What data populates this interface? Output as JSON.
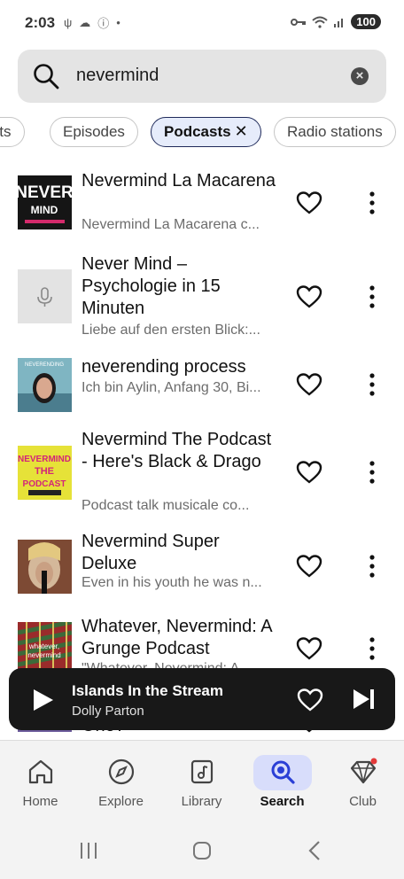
{
  "status_bar": {
    "time": "2:03",
    "battery": "100"
  },
  "search": {
    "query": "nevermind"
  },
  "filters": [
    {
      "label": "ists",
      "active": false
    },
    {
      "label": "Episodes",
      "active": false
    },
    {
      "label": "Podcasts",
      "active": true
    },
    {
      "label": "Radio stations",
      "active": false
    }
  ],
  "results": [
    {
      "title": "Nevermind La Macarena",
      "desc": "Nevermind La Macarena c...",
      "thumb": "nevermind-la-macarena-cover"
    },
    {
      "title": "Never Mind – Psychologie in 15 Minuten",
      "desc": "Liebe auf den ersten Blick:...",
      "thumb": "microphone-placeholder"
    },
    {
      "title": "neverending process",
      "desc": "Ich bin Aylin, Anfang 30, Bi...",
      "thumb": "neverending-process-cover"
    },
    {
      "title": "Nevermind The Podcast - Here's Black & Drago",
      "desc": "Podcast talk musicale co...",
      "thumb": "nevermind-the-podcast-cover"
    },
    {
      "title": "Nevermind Super Deluxe",
      "desc": "Even in his youth he was n...",
      "thumb": "nevermind-super-deluxe-cover"
    },
    {
      "title": "Whatever, Nevermind: A Grunge Podcast",
      "desc": "\"Whatever, Nevermind: A...",
      "thumb": "whatever-nevermind-cover"
    },
    {
      "title": "One?",
      "desc": "",
      "thumb": "partial-cover"
    }
  ],
  "player": {
    "title": "Islands In the Stream",
    "artist": "Dolly Parton"
  },
  "nav": [
    {
      "label": "Home",
      "icon": "home-icon"
    },
    {
      "label": "Explore",
      "icon": "compass-icon"
    },
    {
      "label": "Library",
      "icon": "library-icon"
    },
    {
      "label": "Search",
      "icon": "search-icon",
      "active": true
    },
    {
      "label": "Club",
      "icon": "diamond-icon"
    }
  ],
  "colors": {
    "accent": "#d8ddfb",
    "active_chip": "#e6ecfb",
    "player_bg": "#181818"
  }
}
